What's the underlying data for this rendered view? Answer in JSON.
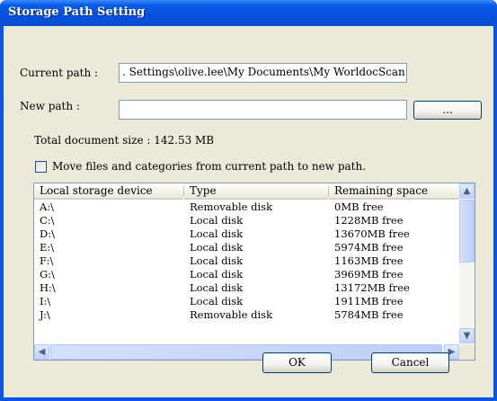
{
  "window": {
    "title": "Storage Path Setting"
  },
  "current_path": {
    "label": "Current path :",
    "value": ". Settings\\olive.lee\\My Documents\\My WorldocScan X"
  },
  "new_path": {
    "label": "New path :",
    "value": "",
    "browse_label": "..."
  },
  "total_size": "Total document size : 142.53 MB",
  "move_option": {
    "label": "Move files and categories from current path to new path.",
    "checked": false
  },
  "devices": {
    "columns": [
      "Local storage device",
      "Type",
      "Remaining space"
    ],
    "rows": [
      {
        "device": "A:\\",
        "type": "Removable disk",
        "space": "0MB free"
      },
      {
        "device": "C:\\",
        "type": "Local disk",
        "space": "1228MB free"
      },
      {
        "device": "D:\\",
        "type": "Local disk",
        "space": "13670MB free"
      },
      {
        "device": "E:\\",
        "type": "Local disk",
        "space": "5974MB free"
      },
      {
        "device": "F:\\",
        "type": "Local disk",
        "space": "1163MB free"
      },
      {
        "device": "G:\\",
        "type": "Local disk",
        "space": "3969MB free"
      },
      {
        "device": "H:\\",
        "type": "Local disk",
        "space": "13172MB free"
      },
      {
        "device": "I:\\",
        "type": "Local disk",
        "space": "1911MB free"
      },
      {
        "device": "J:\\",
        "type": "Removable disk",
        "space": "5784MB free"
      }
    ]
  },
  "buttons": {
    "ok": "OK",
    "cancel": "Cancel"
  }
}
